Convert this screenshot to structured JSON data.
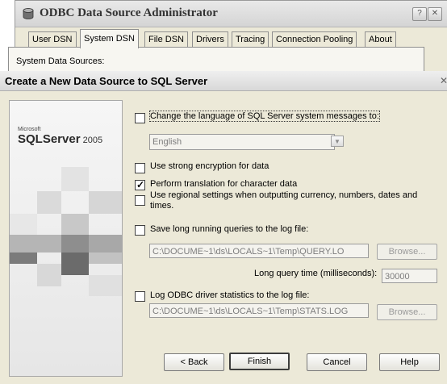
{
  "odbc": {
    "title": "ODBC Data Source Administrator",
    "help_icon": "?",
    "close_icon": "✕",
    "tabs": [
      {
        "label": "User DSN",
        "mnemonic": ""
      },
      {
        "label": "System DSN"
      },
      {
        "label": "File DSN"
      },
      {
        "label": "Drivers"
      },
      {
        "label": "Tracing"
      },
      {
        "label": "Connection Pooling"
      },
      {
        "label": "About"
      }
    ],
    "active_tab": "System DSN",
    "system_sources_label": "System Data Sources:"
  },
  "dialog": {
    "title": "Create a New Data Source to SQL Server",
    "close_icon": "✕",
    "banner": {
      "brand_small": "Microsoft",
      "product": "SQLServer",
      "version": "2005"
    },
    "options": {
      "change_language": {
        "label": "Change the language of SQL Server system messages to:",
        "checked": false
      },
      "language_value": "English",
      "strong_encryption": {
        "label": "Use strong encryption for data",
        "checked": false
      },
      "perform_translation": {
        "label": "Perform translation for character data",
        "checked": true
      },
      "regional_settings": {
        "label": "Use regional settings when outputting currency, numbers, dates and times.",
        "checked": false
      },
      "save_long_queries": {
        "label": "Save long running queries to the log file:",
        "checked": false
      },
      "query_log_path": "C:\\DOCUME~1\\ds\\LOCALS~1\\Temp\\QUERY.LO",
      "browse_label_1": "Browse...",
      "long_query_time_label": "Long query time (milliseconds):",
      "long_query_time_value": "30000",
      "log_odbc_stats": {
        "label": "Log ODBC driver statistics to the log file:",
        "checked": false
      },
      "stats_log_path": "C:\\DOCUME~1\\ds\\LOCALS~1\\Temp\\STATS.LOG",
      "browse_label_2": "Browse..."
    },
    "buttons": {
      "back": "< Back",
      "finish": "Finish",
      "cancel": "Cancel",
      "help": "Help"
    }
  }
}
